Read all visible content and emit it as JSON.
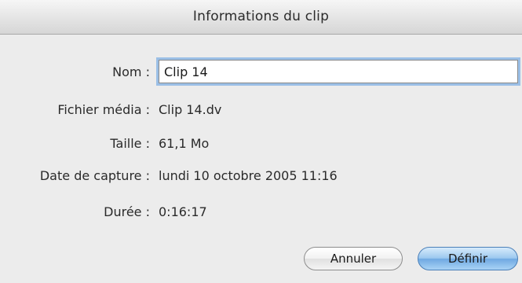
{
  "window": {
    "title": "Informations du clip"
  },
  "fields": {
    "name": {
      "label": "Nom :",
      "value": "Clip 14"
    },
    "media_file": {
      "label": "Fichier média :",
      "value": "Clip 14.dv"
    },
    "size": {
      "label": "Taille :",
      "value": "61,1 Mo"
    },
    "capture_date": {
      "label": "Date de capture :",
      "value": "lundi 10 octobre 2005 11:16"
    },
    "duration": {
      "label": "Durée :",
      "value": "0:16:17"
    }
  },
  "buttons": {
    "cancel": "Annuler",
    "define": "Définir"
  },
  "colors": {
    "default_button": "#6fa9e2",
    "focus_ring": "#9bbfe6"
  }
}
